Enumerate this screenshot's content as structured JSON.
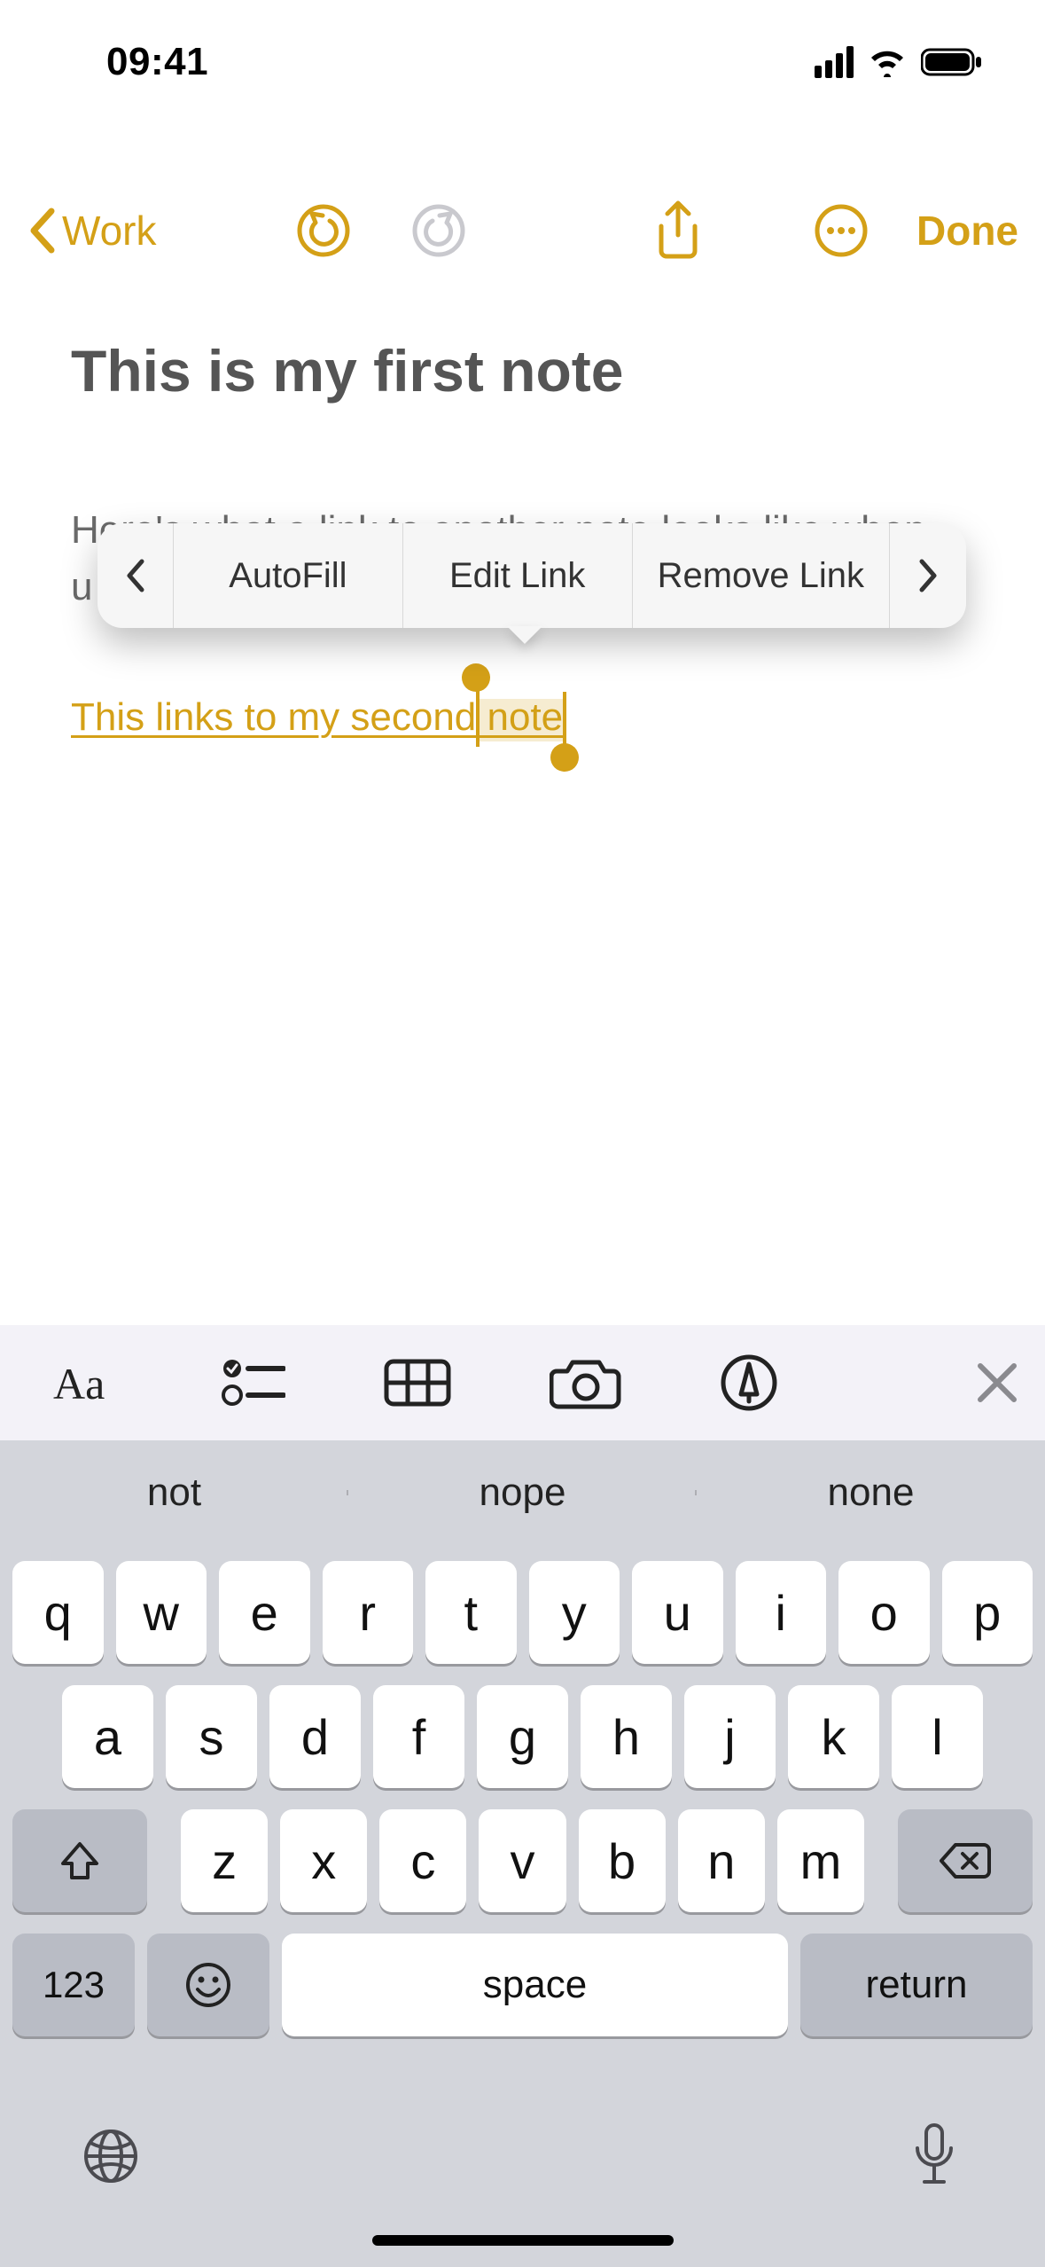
{
  "status": {
    "time": "09:41"
  },
  "nav": {
    "back_label": "Work",
    "done_label": "Done"
  },
  "note": {
    "title": "This is my first note",
    "body_line1": "Here's what a link to another note looks like when",
    "body_line2_prefix": "u",
    "link_text": "This links to my second note"
  },
  "context_menu": {
    "items": [
      "AutoFill",
      "Edit Link",
      "Remove Link"
    ]
  },
  "suggestions": [
    "not",
    "nope",
    "none"
  ],
  "keyboard": {
    "row1": [
      "q",
      "w",
      "e",
      "r",
      "t",
      "y",
      "u",
      "i",
      "o",
      "p"
    ],
    "row2": [
      "a",
      "s",
      "d",
      "f",
      "g",
      "h",
      "j",
      "k",
      "l"
    ],
    "row3": [
      "z",
      "x",
      "c",
      "v",
      "b",
      "n",
      "m"
    ],
    "numeric_label": "123",
    "space_label": "space",
    "return_label": "return"
  },
  "colors": {
    "accent": "#d4a017"
  }
}
